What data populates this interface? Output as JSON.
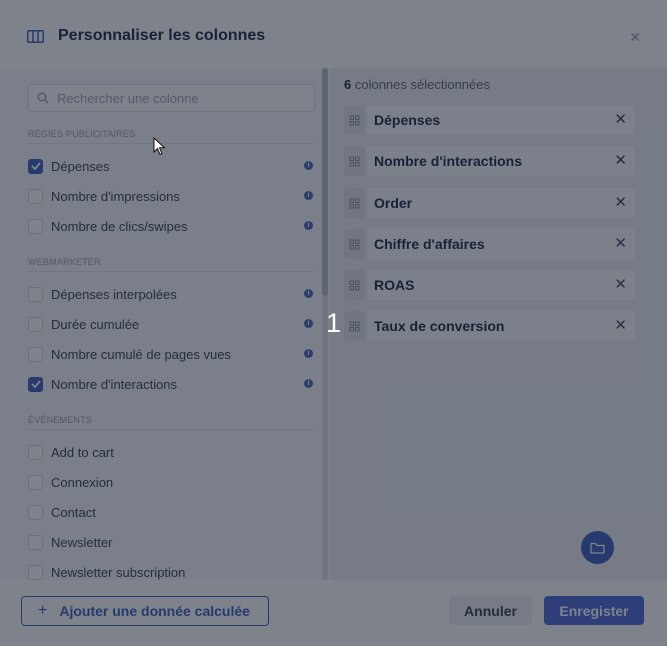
{
  "modal": {
    "title": "Personnaliser les colonnes",
    "close_icon": "close-icon",
    "header_icon": "columns-icon"
  },
  "search": {
    "placeholder": "Rechercher une colonne",
    "icon": "search-icon"
  },
  "sections": [
    {
      "title": "Régies publicitaires",
      "items": [
        {
          "label": "Dépenses",
          "checked": true,
          "info": true
        },
        {
          "label": "Nombre d'impressions",
          "checked": false,
          "info": true
        },
        {
          "label": "Nombre de clics/swipes",
          "checked": false,
          "info": true
        }
      ]
    },
    {
      "title": "Webmarketer",
      "items": [
        {
          "label": "Dépenses interpolées",
          "checked": false,
          "info": true
        },
        {
          "label": "Durée cumulée",
          "checked": false,
          "info": true
        },
        {
          "label": "Nombre cumulé de pages vues",
          "checked": false,
          "info": true
        },
        {
          "label": "Nombre d'interactions",
          "checked": true,
          "info": true
        }
      ]
    },
    {
      "title": "Évènements",
      "items": [
        {
          "label": "Add to cart",
          "checked": false,
          "info": false
        },
        {
          "label": "Connexion",
          "checked": false,
          "info": false
        },
        {
          "label": "Contact",
          "checked": false,
          "info": false
        },
        {
          "label": "Newsletter",
          "checked": false,
          "info": false
        },
        {
          "label": "Newsletter subscription",
          "checked": false,
          "info": false
        }
      ]
    }
  ],
  "selected": {
    "count": "6",
    "count_suffix": " colonnes sélectionnées",
    "columns": [
      "Dépenses",
      "Nombre d'interactions",
      "Order",
      "Chiffre d'affaires",
      "ROAS",
      "Taux de conversion"
    ]
  },
  "overlay_number": "1",
  "footer": {
    "add_label": "Ajouter une donnée calculée",
    "cancel_label": "Annuler",
    "save_label": "Enregister"
  },
  "colors": {
    "accent": "#3f5fbf",
    "overlay": "#141c2c"
  }
}
